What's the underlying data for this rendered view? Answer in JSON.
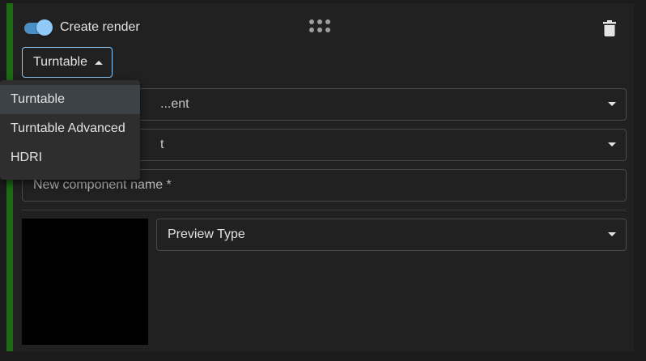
{
  "render_card": {
    "toggle_label": "Create render",
    "toggle_on": true,
    "accent_color": "#1d6b15",
    "type_button_label": "Turntable",
    "fields": {
      "component_placeholder": "...ent",
      "second_placeholder": "t",
      "new_component_placeholder": "New component name *",
      "preview_type_label": "Preview Type"
    },
    "icons": {
      "drag": "drag-handle-icon",
      "delete": "trash-icon"
    }
  },
  "type_menu": {
    "items": [
      "Turntable",
      "Turntable Advanced",
      "HDRI"
    ],
    "selected_index": 0
  }
}
